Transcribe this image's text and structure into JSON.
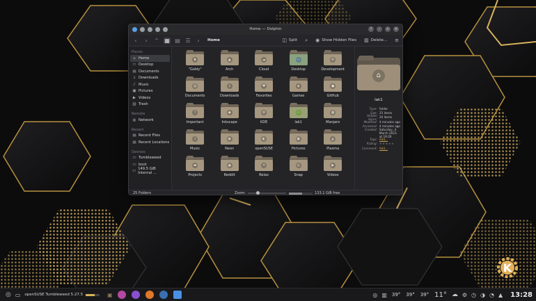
{
  "window": {
    "title": "Home — Dolphin",
    "breadcrumb": "Home",
    "toolbar": {
      "split_label": "Split",
      "show_hidden_label": "Show Hidden Files",
      "delete_label": "Delete..."
    },
    "sidebar": {
      "sections": [
        {
          "heading": "Places",
          "items": [
            {
              "label": "Home",
              "icon": "home-icon",
              "glyph": "⌂",
              "selected": true
            },
            {
              "label": "Desktop",
              "icon": "desktop-icon",
              "glyph": "▭"
            },
            {
              "label": "Documents",
              "icon": "documents-icon",
              "glyph": "▤"
            },
            {
              "label": "Downloads",
              "icon": "downloads-icon",
              "glyph": "↓"
            },
            {
              "label": "Music",
              "icon": "music-icon",
              "glyph": "♪"
            },
            {
              "label": "Pictures",
              "icon": "pictures-icon",
              "glyph": "▣"
            },
            {
              "label": "Videos",
              "icon": "videos-icon",
              "glyph": "▶"
            },
            {
              "label": "Trash",
              "icon": "trash-icon",
              "glyph": "▥"
            }
          ]
        },
        {
          "heading": "Remote",
          "items": [
            {
              "label": "Network",
              "icon": "network-icon",
              "glyph": "◍"
            }
          ]
        },
        {
          "heading": "Recent",
          "items": [
            {
              "label": "Recent Files",
              "icon": "recent-files-icon",
              "glyph": "▤"
            },
            {
              "label": "Recent Locations",
              "icon": "recent-locations-icon",
              "glyph": "▤"
            }
          ]
        },
        {
          "heading": "Devices",
          "items": [
            {
              "label": "Tumbleweed",
              "icon": "drive-icon",
              "glyph": "▭"
            },
            {
              "label": "boot",
              "icon": "drive-icon",
              "glyph": "▭"
            },
            {
              "label": "149.5 GiB Internal ...",
              "icon": "drive-icon",
              "glyph": "▭"
            }
          ]
        }
      ]
    },
    "folders": [
      {
        "name": "\"Goldy\"",
        "glyph": "♞"
      },
      {
        "name": "Arch",
        "glyph": "▲"
      },
      {
        "name": "Cloud",
        "glyph": "☁"
      },
      {
        "name": "Desktop",
        "glyph": "▭",
        "variant": "desk"
      },
      {
        "name": "Development",
        "glyph": "⚙"
      },
      {
        "name": "Documents",
        "glyph": "▤"
      },
      {
        "name": "Downloads",
        "glyph": "↓"
      },
      {
        "name": "Favorites",
        "glyph": "♥"
      },
      {
        "name": "Games",
        "glyph": "◈"
      },
      {
        "name": "GitHub",
        "glyph": "●"
      },
      {
        "name": "Important",
        "glyph": "!"
      },
      {
        "name": "Inkscape",
        "glyph": "◆"
      },
      {
        "name": "KDE",
        "glyph": "⚙"
      },
      {
        "name": "lak1",
        "glyph": "▭",
        "variant": "lak"
      },
      {
        "name": "Manjaro",
        "glyph": "▦"
      },
      {
        "name": "Music",
        "glyph": "♪"
      },
      {
        "name": "Neon",
        "glyph": "◉"
      },
      {
        "name": "openSUSE",
        "glyph": "◐"
      },
      {
        "name": "Pictures",
        "glyph": "▣"
      },
      {
        "name": "Plasma",
        "glyph": "◭"
      },
      {
        "name": "Projects",
        "glyph": "▬"
      },
      {
        "name": "Reddit",
        "glyph": "◕"
      },
      {
        "name": "Relax",
        "glyph": "✕"
      },
      {
        "name": "Snap",
        "glyph": "◎"
      },
      {
        "name": "Videos",
        "glyph": "▶"
      }
    ],
    "info_panel": {
      "name": "lak1",
      "rows": [
        {
          "key": "Type:",
          "value": "folder"
        },
        {
          "key": "Size:",
          "value": "25 items"
        },
        {
          "key": "Hidden items:",
          "value": "20 items"
        },
        {
          "key": "Modified:",
          "value": "4 minutes ago"
        },
        {
          "key": "Accessed:",
          "value": "4 minutes ago"
        },
        {
          "key": "Created:",
          "value": "Saturday, 4 March 2023 at 19:26",
          "tall": true
        },
        {
          "key": "Tags:",
          "value": "Add...",
          "link": true
        },
        {
          "key": "Rating:",
          "value": "★★★★★",
          "stars": true
        },
        {
          "key": "Comment:",
          "value": "Add...",
          "link": true
        }
      ]
    },
    "statusbar": {
      "count": "25 Folders",
      "zoom_label": "Zoom:",
      "free_space": "133.1 GiB free",
      "used_fraction": 0.55
    }
  },
  "taskbar": {
    "device_label": "openSUSE Tumbleweed 5.27.5",
    "temps": [
      "39°",
      "39°",
      "39°"
    ],
    "weather": "11°",
    "clock": "13:28"
  },
  "colors": {
    "accent_gold": "#c7a24a",
    "window_bg": "#242427"
  }
}
